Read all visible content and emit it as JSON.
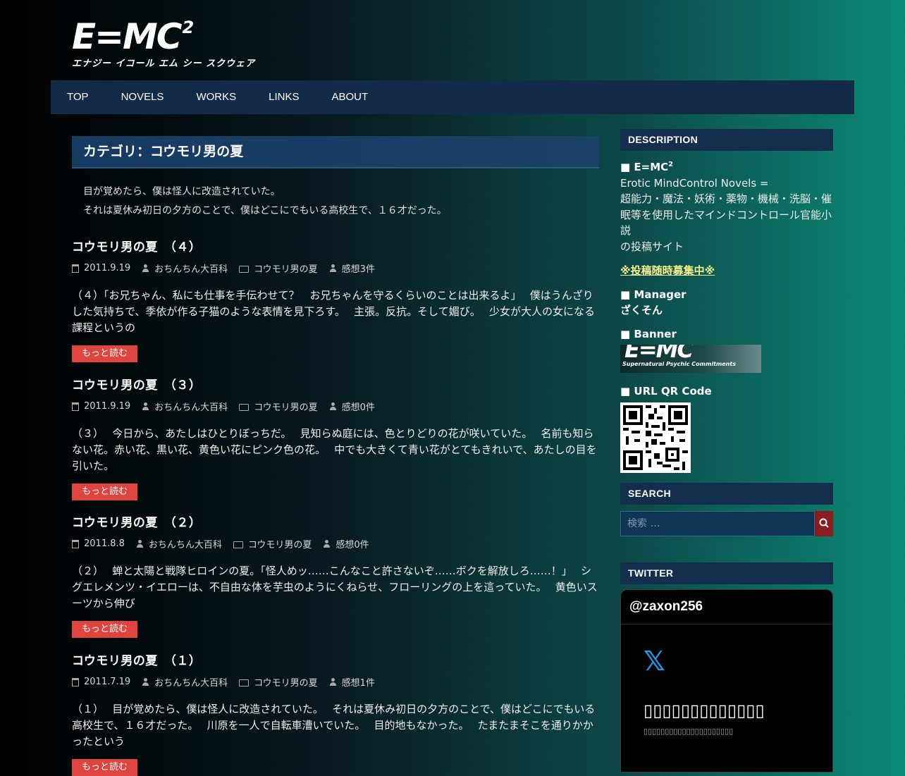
{
  "logo": {
    "main": "E=MC",
    "sup": "2",
    "kana": "エナジー イコール エム シー スクウェア"
  },
  "nav": [
    "TOP",
    "NOVELS",
    "WORKS",
    "LINKS",
    "ABOUT"
  ],
  "category": {
    "title": "カテゴリ：コウモリ男の夏",
    "desc_1": "目が覚めたら、僕は怪人に改造されていた。",
    "desc_2": "それは夏休み初日の夕方のことで、僕はどこにでもいる高校生で、１６才だった。"
  },
  "read_more": "もっと読む",
  "posts": [
    {
      "title": "コウモリ男の夏　（４）",
      "date": "2011.9.19",
      "author": "おちんちん大百科",
      "category": "コウモリ男の夏",
      "comments": "感想3件",
      "excerpt": "（４）「お兄ちゃん、私にも仕事を手伝わせて？　お兄ちゃんを守るくらいのことは出来るよ」　 僕はうんざりした気持ちで、季依が作る子猫のような表情を見下ろす。　 主張。反抗。そして媚び。　 少女が大人の女になる課程というの"
    },
    {
      "title": "コウモリ男の夏　（３）",
      "date": "2011.9.19",
      "author": "おちんちん大百科",
      "category": "コウモリ男の夏",
      "comments": "感想0件",
      "excerpt": "（３）　 今日から、あたしはひとりぼっちだ。　 見知らぬ庭には、色とりどりの花が咲いていた。　 名前も知らない花。赤い花、黒い花、黄色い花にピンク色の花。　 中でも大きくて青い花がとてもきれいで、あたしの目を引いた。"
    },
    {
      "title": "コウモリ男の夏　（２）",
      "date": "2011.8.8",
      "author": "おちんちん大百科",
      "category": "コウモリ男の夏",
      "comments": "感想0件",
      "excerpt": "（２）　 蝉と太陽と戦隊ヒロインの夏。「怪人めッ……こんなこと許さないぞ……ボクを解放しろ……！」　 シグエレメンツ・イエローは、不自由な体を芋虫のようにくねらせ、フローリングの上を這っていた。　 黄色いスーツから伸び"
    },
    {
      "title": "コウモリ男の夏　（１）",
      "date": "2011.7.19",
      "author": "おちんちん大百科",
      "category": "コウモリ男の夏",
      "comments": "感想1件",
      "excerpt": "（１）　 目が覚めたら、僕は怪人に改造されていた。　 それは夏休み初日の夕方のことで、僕はどこにでもいる高校生で、１６才だった。　 川原を一人で自転車漕いでいた。　 目的地もなかった。　 たまたまそこを通りかかったという"
    }
  ],
  "sidebar": {
    "description_heading": "DESCRIPTION",
    "site_name": "■ E=MC",
    "site_sup": "2",
    "tagline": "Erotic MindControl Novels =",
    "desc_body": "超能力・魔法・妖術・薬物・機械・洗脳・催眠等を使用したマインドコントロール官能小説",
    "desc_tail": "の投稿サイト",
    "recruit": "※投稿随時募集中※",
    "manager_heading": "■ Manager",
    "manager_name": "ざくそん",
    "banner_heading": "■ Banner",
    "banner_title": "E=MC",
    "banner_sub": "Supernatural Psychic Commitments",
    "qr_heading": "■ URL QR Code",
    "search_heading": "SEARCH",
    "search_placeholder": "検索 …",
    "twitter_heading": "TWITTER",
    "twitter_handle": "@zaxon256"
  }
}
